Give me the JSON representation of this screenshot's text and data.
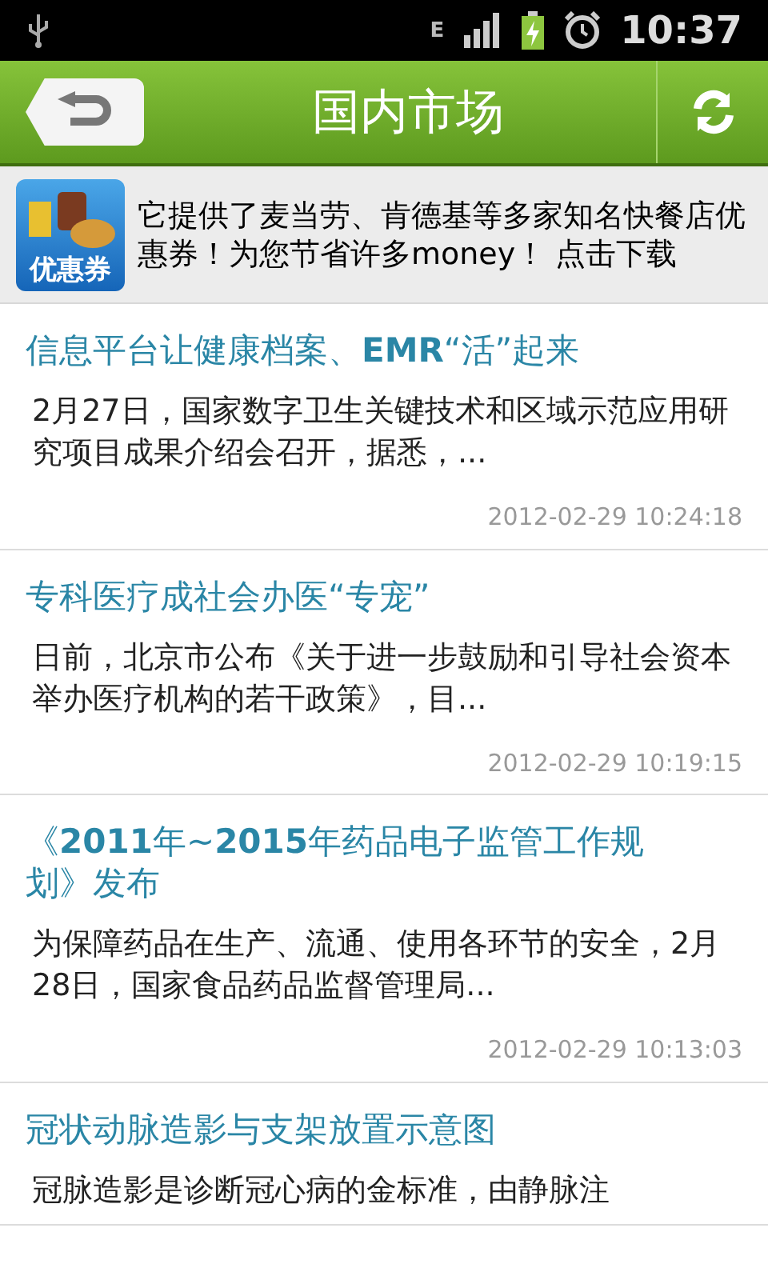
{
  "status_bar": {
    "network": "E",
    "time": "10:37"
  },
  "header": {
    "title": "国内市场"
  },
  "banner": {
    "text": "它提供了麦当劳、肯德基等多家知名快餐店优惠券！为您节省许多money！ 点击下载",
    "icon_label": "优惠券"
  },
  "articles": [
    {
      "title": "信息平台让健康档案、**EMR**“活”起来",
      "summary": "2月27日，国家数字卫生关键技术和区域示范应用研究项目成果介绍会召开，据悉，...",
      "time": "2012-02-29 10:24:18"
    },
    {
      "title": "专科医疗成社会办医“专宠”",
      "summary": "日前，北京市公布《关于进一步鼓励和引导社会资本举办医疗机构的若干政策》，目...",
      "time": "2012-02-29 10:19:15"
    },
    {
      "title": "《**2011**年~**2015**年药品电子监管工作规划》发布",
      "summary": "为保障药品在生产、流通、使用各环节的安全，2月28日，国家食品药品监督管理局...",
      "time": "2012-02-29 10:13:03"
    },
    {
      "title": "冠状动脉造影与支架放置示意图",
      "summary": "冠脉造影是诊断冠心病的金标准，由静脉注"
    }
  ]
}
